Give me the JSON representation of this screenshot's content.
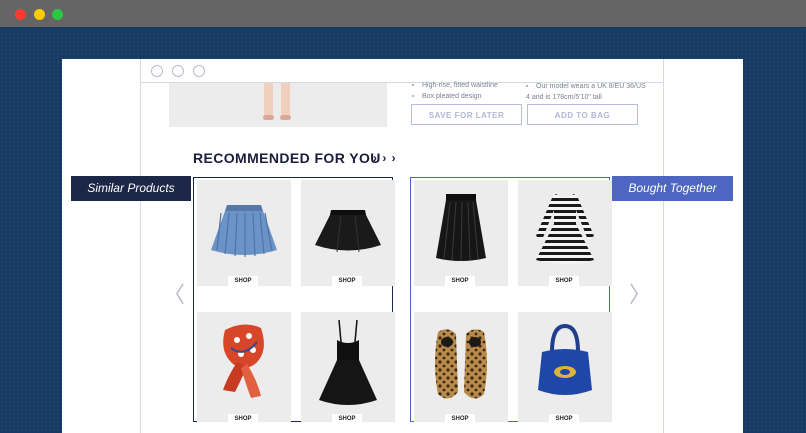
{
  "window_controls": {
    "colors": [
      "#ff3b30",
      "#ffcc00",
      "#28c840"
    ]
  },
  "product": {
    "features_left": [
      "High-rise, fitted waistline",
      "Box pleated design"
    ],
    "features_right": [
      "Our model wears a UK 8/EU 36/US 4 and is 178cm/5'10\" tall"
    ],
    "save_label": "SAVE FOR LATER",
    "add_label": "ADD TO BAG"
  },
  "recommended": {
    "title": "RECOMMENDED FOR YOU",
    "arrows": "› › ›"
  },
  "similar": {
    "tag": "Similar Products",
    "items": [
      {
        "shop": "SHOP",
        "icon": "denim-skirt-icon"
      },
      {
        "shop": "SHOP",
        "icon": "black-skirt-icon"
      },
      {
        "shop": "SHOP",
        "icon": "scarf-icon"
      },
      {
        "shop": "SHOP",
        "icon": "black-dress-icon"
      }
    ]
  },
  "together": {
    "tag": "Bought Together",
    "items": [
      {
        "shop": "SHOP",
        "icon": "pleated-skirt-icon"
      },
      {
        "shop": "SHOP",
        "icon": "striped-dress-icon"
      },
      {
        "shop": "SHOP",
        "icon": "leopard-loafers-icon"
      },
      {
        "shop": "SHOP",
        "icon": "blue-handbag-icon"
      }
    ]
  },
  "nav": {
    "prev": "〈",
    "next": "〉"
  },
  "colors": {
    "background": "#163a63",
    "titlebar": "#666565",
    "similar_accent": "#1c2646",
    "together_accent": "#4c66c2",
    "tile": "#ececec"
  }
}
